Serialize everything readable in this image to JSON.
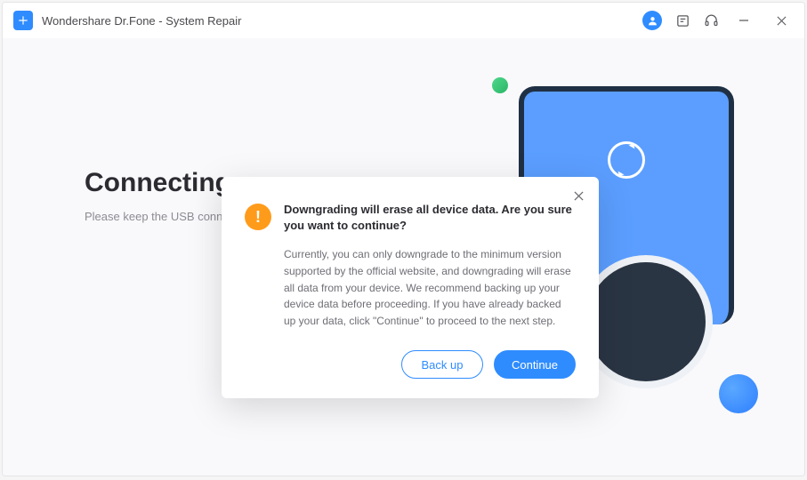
{
  "titlebar": {
    "title": "Wondershare Dr.Fone - System Repair"
  },
  "page": {
    "heading": "Connecting.",
    "subtext": "Please keep the USB connection"
  },
  "modal": {
    "title": "Downgrading will erase all device data. Are you sure you want to continue?",
    "body": "Currently, you can only downgrade to the minimum version supported by the official website, and downgrading will erase all data from your device. We recommend backing up your device data before proceeding. If you have already backed up your data, click \"Continue\" to proceed to the next step.",
    "backup_label": "Back up",
    "continue_label": "Continue"
  }
}
